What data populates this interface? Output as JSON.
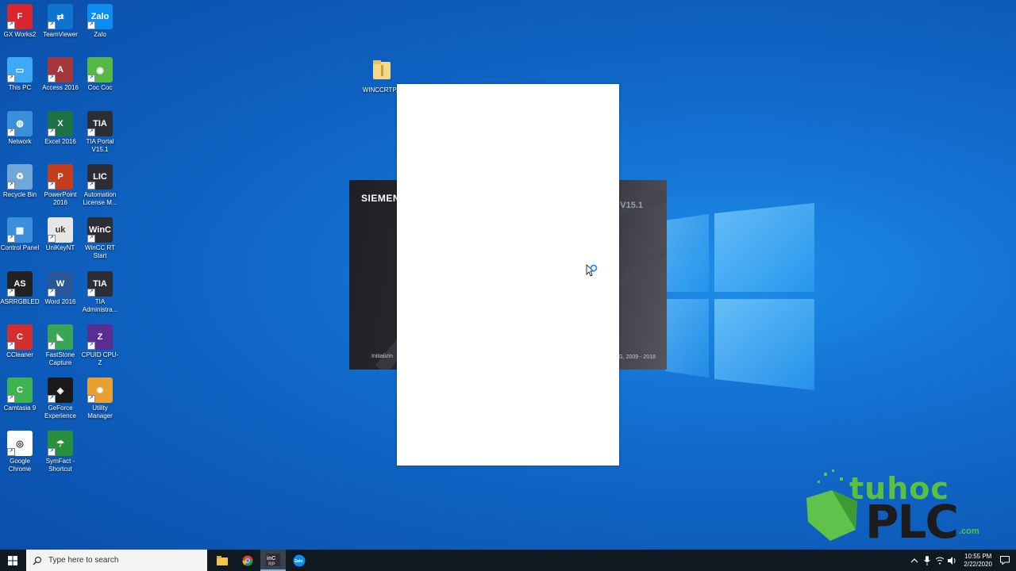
{
  "desktop": {
    "icons": [
      {
        "label": "GX Works2",
        "glyph": "F",
        "color": "#d9262c"
      },
      {
        "label": "TeamViewer",
        "glyph": "⇄",
        "color": "#0e73cc"
      },
      {
        "label": "Zalo",
        "glyph": "Zalo",
        "color": "#0a8cf0"
      },
      {
        "label": "This PC",
        "glyph": "▭",
        "color": "#3fa9f5"
      },
      {
        "label": "Access 2016",
        "glyph": "A",
        "color": "#a4373a"
      },
      {
        "label": "Coc Coc",
        "glyph": "◉",
        "color": "#57b846"
      },
      {
        "label": "Network",
        "glyph": "◍",
        "color": "#3a8fd9"
      },
      {
        "label": "Excel 2016",
        "glyph": "X",
        "color": "#1e7145"
      },
      {
        "label": "TIA Portal V15.1",
        "glyph": "TIA",
        "color": "#2d2d35"
      },
      {
        "label": "Recycle Bin",
        "glyph": "♻",
        "color": "#6fa8d8"
      },
      {
        "label": "PowerPoint 2016",
        "glyph": "P",
        "color": "#c43e1c"
      },
      {
        "label": "Automation License M...",
        "glyph": "LIC",
        "color": "#2d2d35"
      },
      {
        "label": "Control Panel",
        "glyph": "▦",
        "color": "#3a8fd9"
      },
      {
        "label": "UniKeyNT",
        "glyph": "uk",
        "color": "#e6e6e6"
      },
      {
        "label": "WinCC RT Start",
        "glyph": "WinC",
        "color": "#2d2d35"
      },
      {
        "label": "ASRRGBLED",
        "glyph": "AS",
        "color": "#222222"
      },
      {
        "label": "Word 2016",
        "glyph": "W",
        "color": "#2b579a"
      },
      {
        "label": "TIA Administra...",
        "glyph": "TIA",
        "color": "#2d2d35"
      },
      {
        "label": "CCleaner",
        "glyph": "C",
        "color": "#d32f2f"
      },
      {
        "label": "FastStone Capture",
        "glyph": "◣",
        "color": "#3aa655"
      },
      {
        "label": "CPUID CPU-Z",
        "glyph": "Z",
        "color": "#5a2d91"
      },
      {
        "label": "Camtasia 9",
        "glyph": "C",
        "color": "#3fb34f"
      },
      {
        "label": "GeForce Experience",
        "glyph": "◈",
        "color": "#1a1a1a"
      },
      {
        "label": "Utility Manager",
        "glyph": "✹",
        "color": "#e8a030"
      },
      {
        "label": "Google Chrome",
        "glyph": "◎",
        "color": "#ffffff"
      },
      {
        "label": "SymFact - Shortcut",
        "glyph": "☂",
        "color": "#2a8f3a"
      }
    ],
    "folder_label": "WINCCRTP..."
  },
  "splash": {
    "brand": "SIEMEN",
    "version": "V15.1",
    "status": "Initializin",
    "copyright": "G, 2009 - 2018"
  },
  "watermark": {
    "top": "tuhoc",
    "bottom": "PLC",
    "suffix": ".com"
  },
  "taskbar": {
    "search_placeholder": "Type here to search",
    "clock_time": "10:55 PM",
    "clock_date": "2/22/2020"
  }
}
